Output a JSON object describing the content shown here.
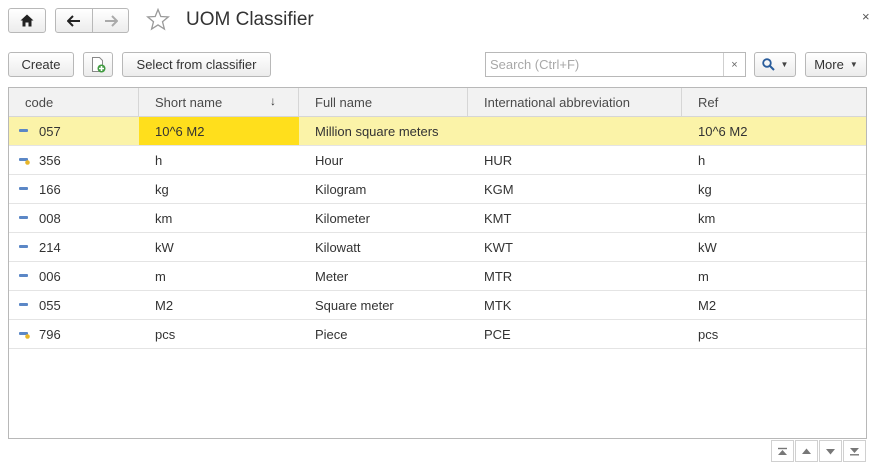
{
  "header": {
    "title": "UOM Classifier",
    "home_icon": "home-icon",
    "back_icon": "arrow-left-icon",
    "forward_icon": "arrow-right-icon",
    "favorite_icon": "star-icon",
    "close_icon": "close-icon",
    "close_glyph": "×"
  },
  "toolbar": {
    "create_label": "Create",
    "add_copy_icon": "document-add-icon",
    "select_label": "Select from classifier",
    "search_placeholder": "Search (Ctrl+F)",
    "search_clear_glyph": "×",
    "search_icon": "magnifier-icon",
    "more_label": "More"
  },
  "table": {
    "columns": [
      "code",
      "Short name",
      "Full name",
      "International abbreviation",
      "Ref"
    ],
    "sort_indicator": "↓",
    "rows": [
      {
        "code": "057",
        "short": "10^6 M2",
        "full": "Million square meters",
        "intl": "",
        "ref": "10^6 M2",
        "icon": "item-icon",
        "selected": true
      },
      {
        "code": "356",
        "short": "h",
        "full": "Hour",
        "intl": "HUR",
        "ref": "h",
        "icon": "item-marked-icon",
        "selected": false
      },
      {
        "code": "166",
        "short": "kg",
        "full": "Kilogram",
        "intl": "KGM",
        "ref": "kg",
        "icon": "item-icon",
        "selected": false
      },
      {
        "code": "008",
        "short": "km",
        "full": "Kilometer",
        "intl": "KMT",
        "ref": "km",
        "icon": "item-icon",
        "selected": false
      },
      {
        "code": "214",
        "short": "kW",
        "full": "Kilowatt",
        "intl": "KWT",
        "ref": "kW",
        "icon": "item-icon",
        "selected": false
      },
      {
        "code": "006",
        "short": "m",
        "full": "Meter",
        "intl": "MTR",
        "ref": "m",
        "icon": "item-icon",
        "selected": false
      },
      {
        "code": "055",
        "short": "M2",
        "full": "Square meter",
        "intl": "MTK",
        "ref": "M2",
        "icon": "item-icon",
        "selected": false
      },
      {
        "code": "796",
        "short": "pcs",
        "full": "Piece",
        "intl": "PCE",
        "ref": "pcs",
        "icon": "item-marked-icon",
        "selected": false
      }
    ]
  },
  "navigation": {
    "buttons": [
      "scroll-first-icon",
      "scroll-up-icon",
      "scroll-down-icon",
      "scroll-last-icon"
    ]
  },
  "colors": {
    "selected_row": "#fbf3a8",
    "selected_cell": "#ffdf1c",
    "item_icon": "#5b87c6",
    "marked_dot": "#e8b628"
  }
}
